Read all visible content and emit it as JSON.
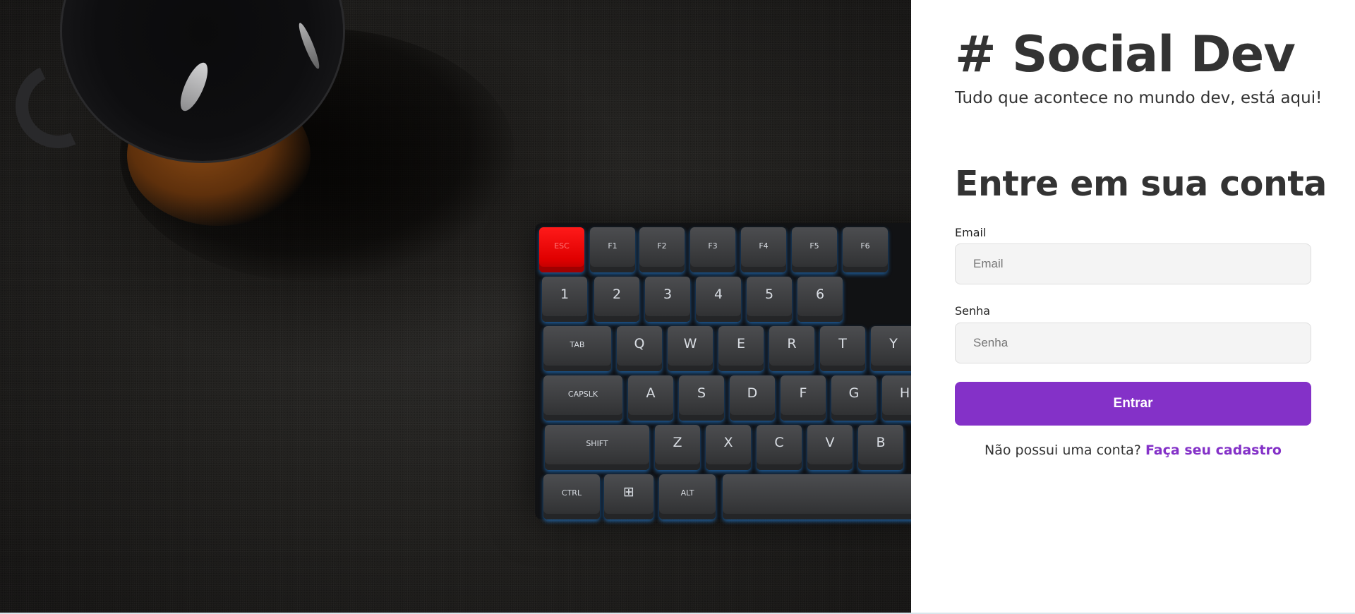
{
  "hero": {
    "keyboard_keys": [
      {
        "label": "ESC",
        "variant": "red"
      },
      {
        "label": "F1"
      },
      {
        "label": "F2"
      },
      {
        "label": "F3"
      },
      {
        "label": "F4"
      },
      {
        "label": "F5"
      },
      {
        "label": "F6"
      },
      {
        "label": "1"
      },
      {
        "label": "2"
      },
      {
        "label": "3"
      },
      {
        "label": "4"
      },
      {
        "label": "5"
      },
      {
        "label": "6"
      },
      {
        "label": "TAB"
      },
      {
        "label": "Q"
      },
      {
        "label": "W"
      },
      {
        "label": "E"
      },
      {
        "label": "R"
      },
      {
        "label": "T"
      },
      {
        "label": "Y"
      },
      {
        "label": "CAPSLK"
      },
      {
        "label": "A"
      },
      {
        "label": "S"
      },
      {
        "label": "D"
      },
      {
        "label": "F"
      },
      {
        "label": "G"
      },
      {
        "label": "H"
      },
      {
        "label": "SHIFT"
      },
      {
        "label": "Z"
      },
      {
        "label": "X"
      },
      {
        "label": "C"
      },
      {
        "label": "V"
      },
      {
        "label": "B"
      },
      {
        "label": "CTRL"
      },
      {
        "label": "⊞"
      },
      {
        "label": "ALT"
      },
      {
        "label": ""
      }
    ]
  },
  "brand": {
    "title": "# Social Dev",
    "tagline": "Tudo que acontece no mundo dev, está aqui!"
  },
  "login": {
    "heading": "Entre em sua conta",
    "email_label": "Email",
    "email_placeholder": "Email",
    "email_value": "",
    "password_label": "Senha",
    "password_placeholder": "Senha",
    "password_value": "",
    "submit_label": "Entrar",
    "signup_prompt": "Não possui uma conta?",
    "signup_link": "Faça seu cadastro"
  },
  "colors": {
    "accent": "#8431c8",
    "text": "#333333",
    "input_bg": "#f4f4f4"
  }
}
